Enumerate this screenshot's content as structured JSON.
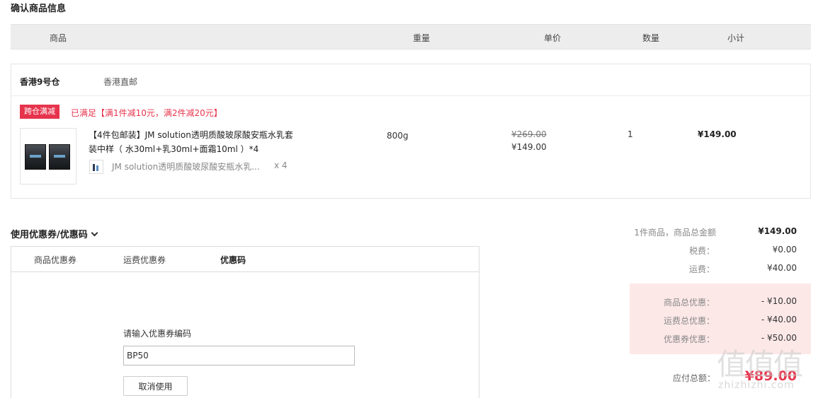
{
  "page": {
    "title": "确认商品信息"
  },
  "table_header": {
    "product": "商品",
    "weight": "重量",
    "unit_price": "单价",
    "quantity": "数量",
    "subtotal": "小计"
  },
  "warehouse": {
    "name": "香港9号仓",
    "shipping": "香港直邮"
  },
  "promo": {
    "tag": "跨仓满减",
    "text": "已满足【满1件减10元，满2件减20元】"
  },
  "product": {
    "title": "【4件包邮装】JM solution透明质酸玻尿酸安瓶水乳套装中样（ 水30ml+乳30ml+面霜10ml ）*4",
    "sub_name": "JM solution透明质酸玻尿酸安瓶水乳...",
    "sub_qty": "x 4",
    "weight": "800g",
    "price_original": "¥269.00",
    "price_current": "¥149.00",
    "quantity": "1",
    "subtotal": "¥149.00"
  },
  "coupon": {
    "heading": "使用优惠券/优惠码",
    "tabs": [
      "商品优惠券",
      "运费优惠券",
      "优惠码"
    ],
    "code_label": "请输入优惠券编码",
    "code_value": "BP50",
    "cancel_label": "取消使用"
  },
  "summary": {
    "goods_label": "1件商品，商品总金额",
    "goods_value": "¥149.00",
    "tax_label": "税费：",
    "tax_value": "¥0.00",
    "shipping_label": "运费：",
    "shipping_value": "¥40.00",
    "goods_discount_label": "商品总优惠：",
    "goods_discount_value": "- ¥10.00",
    "shipping_discount_label": "运费总优惠：",
    "shipping_discount_value": "- ¥40.00",
    "coupon_discount_label": "优惠券优惠：",
    "coupon_discount_value": "- ¥50.00",
    "total_label": "应付总额：",
    "total_value": "¥89.00"
  },
  "watermark": {
    "main": "值值值",
    "sub": "zhizhizhi.com"
  },
  "colors": {
    "accent": "#e6344d",
    "header_bg": "#ededed",
    "discount_bg": "#fde8e8"
  }
}
